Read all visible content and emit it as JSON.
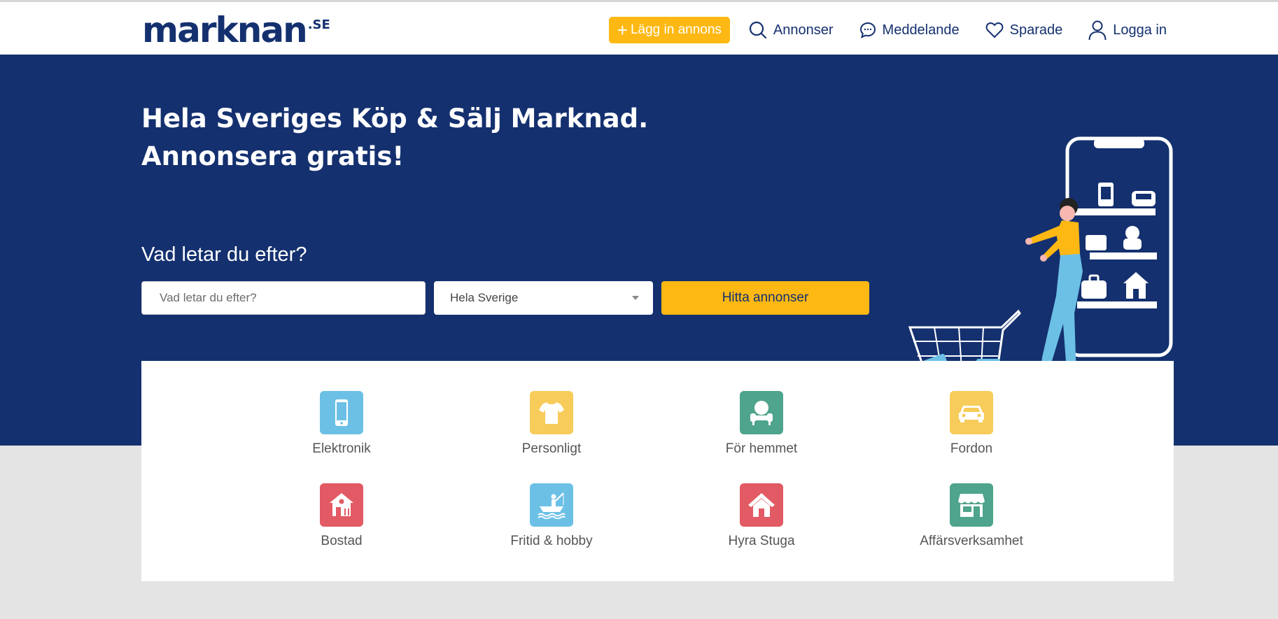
{
  "header": {
    "logo_text": "marknan",
    "logo_suffix": ".SE",
    "post_ad_label": "Lägg in annons",
    "nav": [
      {
        "label": "Annonser",
        "icon": "search-icon"
      },
      {
        "label": "Meddelande",
        "icon": "chat-icon"
      },
      {
        "label": "Sparade",
        "icon": "heart-icon"
      },
      {
        "label": "Logga in",
        "icon": "user-icon"
      }
    ]
  },
  "hero": {
    "title_line1": "Hela Sveriges Köp & Sälj Marknad.",
    "title_line2": "Annonsera gratis!",
    "search_label": "Vad letar du efter?",
    "search_placeholder": "Vad letar du efter?",
    "region_selected": "Hela Sverige",
    "find_button": "Hitta annonser"
  },
  "categories": [
    {
      "label": "Elektronik",
      "icon": "phone-icon",
      "color": "#6cc0e5"
    },
    {
      "label": "Personligt",
      "icon": "tshirt-icon",
      "color": "#f8cc5a"
    },
    {
      "label": "För hemmet",
      "icon": "armchair-icon",
      "color": "#4ea48c"
    },
    {
      "label": "Fordon",
      "icon": "car-icon",
      "color": "#f8cc5a"
    },
    {
      "label": "Bostad",
      "icon": "house-icon",
      "color": "#e25a63"
    },
    {
      "label": "Fritid & hobby",
      "icon": "fishing-boat-icon",
      "color": "#6cc0e5"
    },
    {
      "label": "Hyra Stuga",
      "icon": "cabin-icon",
      "color": "#e25a63"
    },
    {
      "label": "Affärsverksamhet",
      "icon": "store-icon",
      "color": "#4ea48c"
    }
  ],
  "colors": {
    "brand_navy": "#14306f",
    "accent_yellow": "#fdb813",
    "background_gray": "#e4e4e4"
  }
}
